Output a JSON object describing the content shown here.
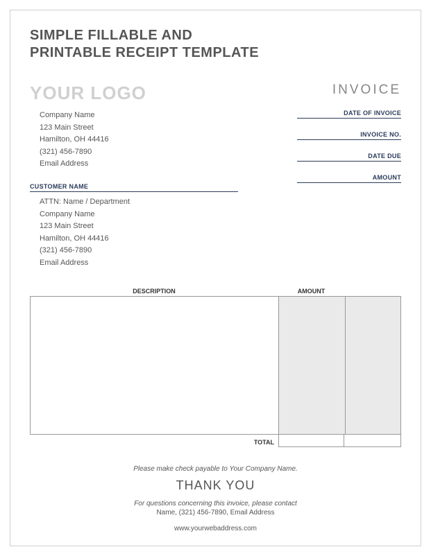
{
  "title_line1": "SIMPLE FILLABLE AND",
  "title_line2": "PRINTABLE RECEIPT TEMPLATE",
  "logo_placeholder": "YOUR LOGO",
  "invoice_word": "INVOICE",
  "company": {
    "name": "Company Name",
    "street": "123 Main Street",
    "city": "Hamilton, OH  44416",
    "phone": "(321) 456-7890",
    "email": "Email Address"
  },
  "meta": {
    "date_of_invoice_label": "DATE OF INVOICE",
    "invoice_no_label": "INVOICE NO.",
    "date_due_label": "DATE DUE",
    "amount_label": "AMOUNT"
  },
  "customer_section_label": "CUSTOMER NAME",
  "customer": {
    "attn": "ATTN: Name / Department",
    "name": "Company Name",
    "street": "123 Main Street",
    "city": "Hamilton, OH  44416",
    "phone": "(321) 456-7890",
    "email": "Email Address"
  },
  "table": {
    "description_label": "DESCRIPTION",
    "amount_label": "AMOUNT",
    "total_label": "TOTAL"
  },
  "footer": {
    "payable": "Please make check payable to Your Company Name.",
    "thanks": "THANK YOU",
    "contact_line1": "For questions concerning this invoice, please contact",
    "contact_line2": "Name, (321) 456-7890, Email Address",
    "web": "www.yourwebaddress.com"
  }
}
